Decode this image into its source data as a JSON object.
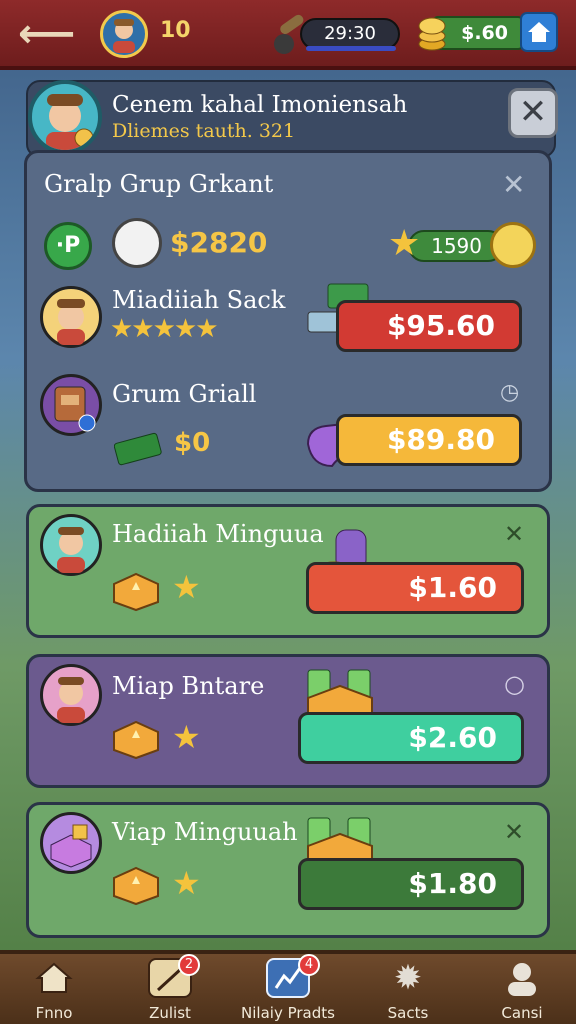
{
  "topbar": {
    "back_icon": "back-arrow-icon",
    "level": "10",
    "timer": "29:30",
    "coins": "$.60",
    "home_icon": "home-icon"
  },
  "header": {
    "title": "Cenem kahal Imoniensah",
    "subtitle": "Dliemes tauth. 321",
    "close_label": "✕"
  },
  "panel": {
    "title": "Gralp Grup Grkant",
    "close_label": "✕",
    "p_label": "·P",
    "gold_amount": "$2820",
    "star_count": "1590",
    "rows": [
      {
        "name": "Miadiiah Sack",
        "stars": "★★★★★",
        "price": "$95.60",
        "price_color": "#d23a33"
      },
      {
        "name": "Grum Griall",
        "amount": "$0",
        "price": "$89.80",
        "price_color": "#f5b83a"
      }
    ]
  },
  "cards": [
    {
      "name": "Hadiiah Minguua",
      "star": "★",
      "price": "$1.60",
      "bg": "#6fa86a",
      "price_color": "#e4553b",
      "corner": "✕"
    },
    {
      "name": "Miap Bntare",
      "star": "★",
      "price": "$2.60",
      "bg": "#6b5a8e",
      "price_color": "#3fcf9f",
      "corner": "○"
    },
    {
      "name": "Viap Minguuah",
      "star": "★",
      "price": "$1.80",
      "bg": "#6fa86a",
      "price_color": "#3c7a3a",
      "corner": "✕"
    }
  ],
  "nav": [
    {
      "label": "Fnno",
      "icon": "home-icon"
    },
    {
      "label": "Zulist",
      "icon": "quest-scroll-icon",
      "badge": "2"
    },
    {
      "label": "Nilaiy Pradts",
      "icon": "prize-icon",
      "badge": "4"
    },
    {
      "label": "Sacts",
      "icon": "gear-icon"
    },
    {
      "label": "Cansi",
      "icon": "profile-icon"
    }
  ]
}
